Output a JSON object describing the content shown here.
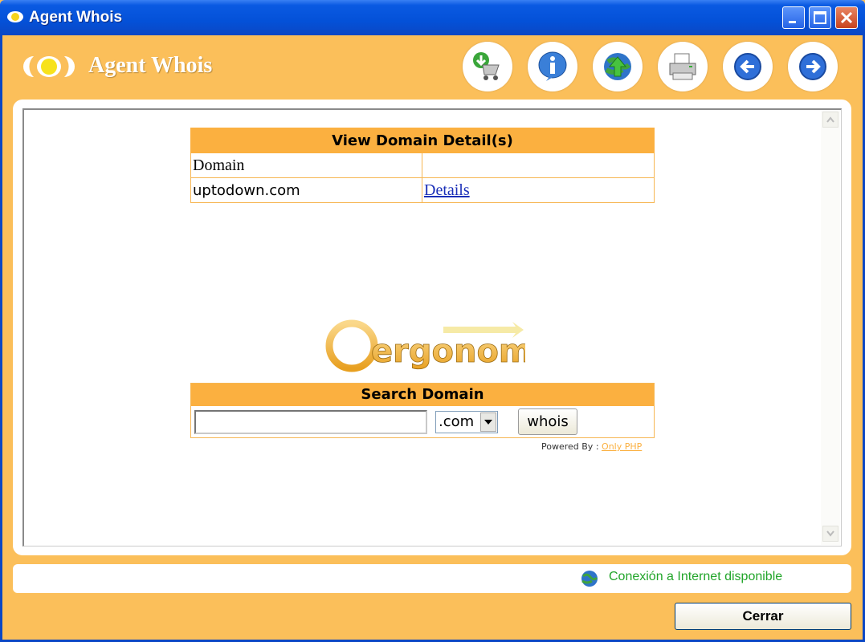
{
  "window": {
    "title": "Agent Whois"
  },
  "header": {
    "title": "Agent Whois"
  },
  "toolbar": {
    "buttons": [
      "update-cart-icon",
      "info-icon",
      "globe-upload-icon",
      "printer-icon",
      "back-arrow-icon",
      "forward-arrow-icon"
    ]
  },
  "domain_table": {
    "title": "View Domain Detail(s)",
    "header_cell": "Domain",
    "rows": [
      {
        "domain": "uptodown.com",
        "link": "Details"
      }
    ]
  },
  "logo": {
    "text": "ergonomy"
  },
  "search": {
    "title": "Search Domain",
    "input_value": "",
    "tld_selected": ".com",
    "button": "whois"
  },
  "powered": {
    "label": "Powered By :",
    "link": "Only PHP"
  },
  "status": {
    "text": "Conexión a Internet disponible"
  },
  "footer": {
    "close_button": "Cerrar"
  },
  "colors": {
    "accent": "#fbb040",
    "status_green": "#22a52a",
    "title_blue": "#0451d8"
  }
}
